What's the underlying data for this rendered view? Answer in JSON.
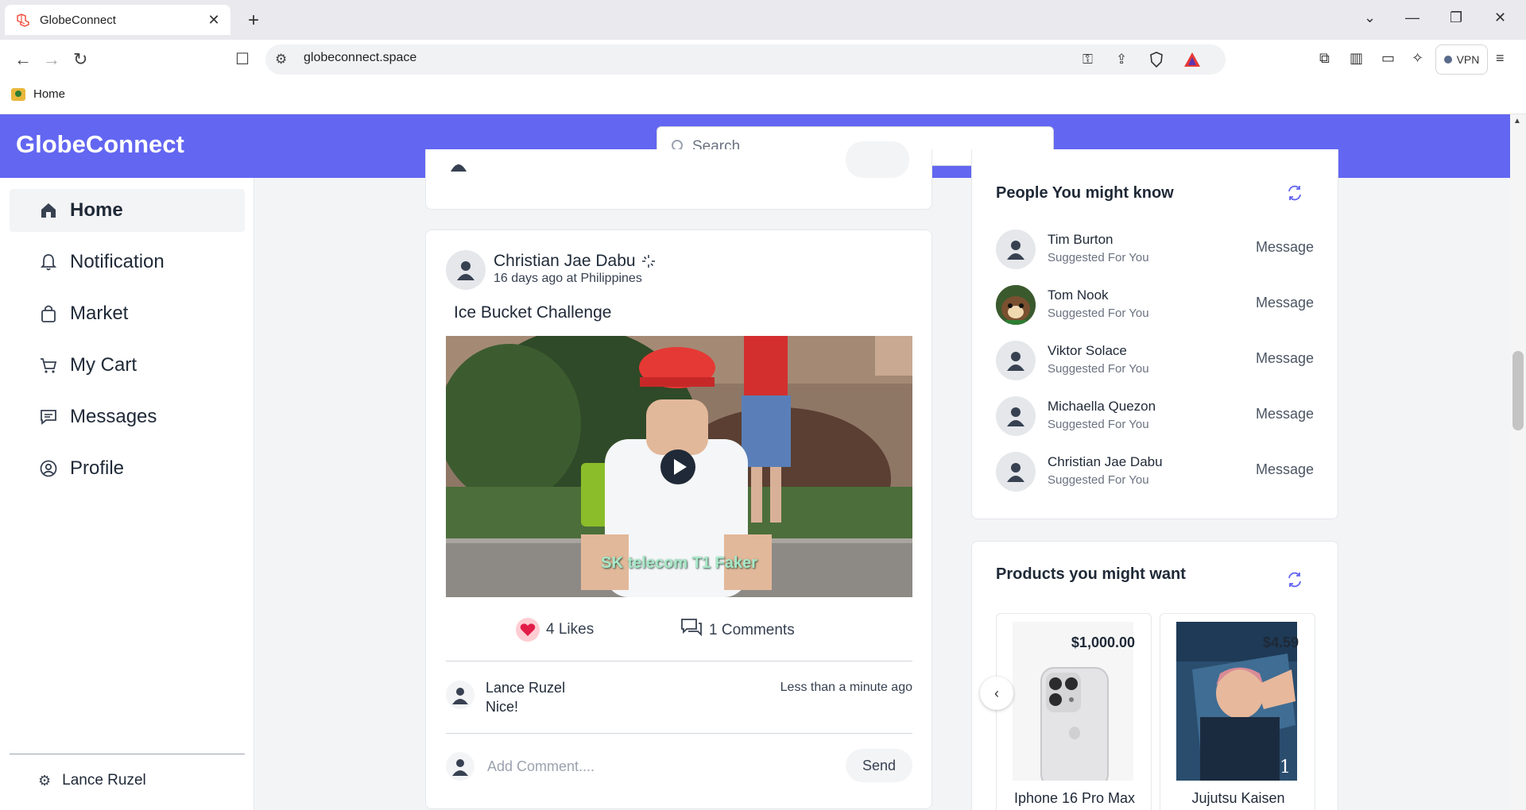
{
  "browser": {
    "tab_title": "GlobeConnect",
    "url": "globeconnect.space",
    "vpn_label": "VPN",
    "bookmark_label": "Home"
  },
  "app": {
    "brand": "GlobeConnect",
    "accent_color": "#6366f1",
    "search_placeholder": "Search"
  },
  "sidebar": {
    "items": [
      {
        "label": "Home",
        "icon": "home-icon",
        "active": true
      },
      {
        "label": "Notification",
        "icon": "bell-icon"
      },
      {
        "label": "Market",
        "icon": "shopping-bag-icon"
      },
      {
        "label": "My Cart",
        "icon": "cart-icon"
      },
      {
        "label": "Messages",
        "icon": "message-icon"
      },
      {
        "label": "Profile",
        "icon": "user-circle-icon"
      }
    ],
    "user_name": "Lance Ruzel"
  },
  "post": {
    "author": "Christian Jae Dabu",
    "time": "16 days ago",
    "location_prefix": "at",
    "location": "Philippines",
    "caption": "Ice Bucket Challenge",
    "video_caption": "SK telecom T1 Faker",
    "likes": "4 Likes",
    "comments": "1 Comments",
    "comment": {
      "author": "Lance Ruzel",
      "text": "Nice!",
      "time": "Less than a minute ago"
    },
    "add_comment_placeholder": "Add Comment....",
    "send_label": "Send"
  },
  "people": {
    "title": "People You might know",
    "items": [
      {
        "name": "Tim Burton",
        "subtitle": "Suggested For You",
        "action": "Message"
      },
      {
        "name": "Tom Nook",
        "subtitle": "Suggested For You",
        "action": "Message"
      },
      {
        "name": "Viktor Solace",
        "subtitle": "Suggested For You",
        "action": "Message"
      },
      {
        "name": "Michaella Quezon",
        "subtitle": "Suggested For You",
        "action": "Message"
      },
      {
        "name": "Christian Jae Dabu",
        "subtitle": "Suggested For You",
        "action": "Message"
      }
    ]
  },
  "products": {
    "title": "Products you might want",
    "items": [
      {
        "name": "Iphone 16 Pro Max",
        "price": "$1,000.00"
      },
      {
        "name": "Jujutsu Kaisen",
        "price": "$4.59"
      }
    ]
  }
}
